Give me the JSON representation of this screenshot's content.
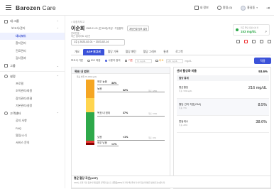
{
  "brand": {
    "name_bold": "Barozen",
    "name_light": "Care"
  },
  "topbar": {
    "info": "내 정보",
    "alerts": "알림 (0)",
    "user": "홍길동",
    "logout_icon": "logout-icon"
  },
  "sidebar": {
    "sections": [
      {
        "label": "내 그룹",
        "icon": "folder-icon"
      },
      {
        "label": "보고서/관리",
        "icon": "chart-icon"
      }
    ],
    "subitems": [
      "대시보드",
      "환자관리",
      "진료관리",
      "검사결과"
    ],
    "active": "대시보드",
    "group2": {
      "label": "그룹",
      "icon": "group-icon"
    },
    "settings": {
      "label": "설정",
      "icon": "gear-icon",
      "items": [
        "프로필",
        "조직관리/회원",
        "장치관리/연결",
        "기본관리/설정"
      ]
    },
    "support": {
      "label": "고객센터",
      "icon": "support-icon",
      "items": [
        "공지 사항",
        "FAQ",
        "알림/소식",
        "서비스 문의"
      ]
    }
  },
  "patient": {
    "breadcrumb": "> 내환자보고",
    "name": "이순희",
    "info": "1962-01-21 (만 63세) 여성 · 가입환자",
    "link": "계정연결 정보 설정",
    "meta1": "관리번호 -",
    "meta2": "최근 업데이트 1분전"
  },
  "cgm": {
    "label": "최근 혈당 측정 1분 전",
    "value": "153 mg/dL"
  },
  "date_range": "1주 | 2023-02-01 ~ 2023-02-14",
  "tabs": [
    "개요",
    "AGP 보고서",
    "혈당 기록",
    "혈당 패턴",
    "혈당 그래프",
    "통계",
    "로그북"
  ],
  "active_tab": "AGP 보고서",
  "filter": {
    "label": "보고서 기준",
    "opt1": "IDC 최종",
    "opt2": "사용자 정의",
    "low_label": "기준",
    "low_placeholder": "70 mg/dL",
    "high_label": "비교",
    "high_placeholder": "180 mg/dL",
    "unit": "mg/dL",
    "apply": "적용"
  },
  "tir": {
    "title": "목표 내 범위",
    "subtitle": "목표 범위 70-180mg/dL",
    "bands": [
      {
        "name": "매우 높음",
        "range": ">250 mg/dL",
        "pct": "34%",
        "color": "#f5a623"
      },
      {
        "name": "높음",
        "range": "181-250 mg/dL",
        "pct": "62%",
        "note": "목표 <25%",
        "color": "#ffd54f"
      },
      {
        "name": "목표 내 범위",
        "range": "70-180 mg/dL",
        "pct": "37%",
        "note": "목표 >70%",
        "color": "#2ea94a"
      },
      {
        "name": "낮음",
        "range": "54-69 mg/dL",
        "pct": "<1%",
        "note": "목표 <4%",
        "color": "#e53935"
      },
      {
        "name": "매우 낮음",
        "range": "<54 mg/dL",
        "pct": "<1%",
        "color": "#8b0000"
      }
    ]
  },
  "right_panel": {
    "title": "센서 활성화 비율",
    "value": "93.6%",
    "sub": "혈당 통계",
    "metrics": [
      {
        "label": "평균혈당",
        "sub": "목표 <154mg/dL",
        "value": "216 mg/dL"
      },
      {
        "label": "혈당 관리 지표(GMI)",
        "sub": "목표 <7%",
        "value": "8.5%"
      },
      {
        "label": "변동계수",
        "sub": "목표 ≤36%",
        "value": "38.6%"
      }
    ]
  },
  "agp": {
    "title": "평균 혈당 곡선(AGP)",
    "desc": "AGP는 조회 기간 동안의 혈당값을 요약한 것으로, 중앙값(50%)과 기타 백분위수가 하루 동안 발생한 것처럼 표시됩니다."
  }
}
